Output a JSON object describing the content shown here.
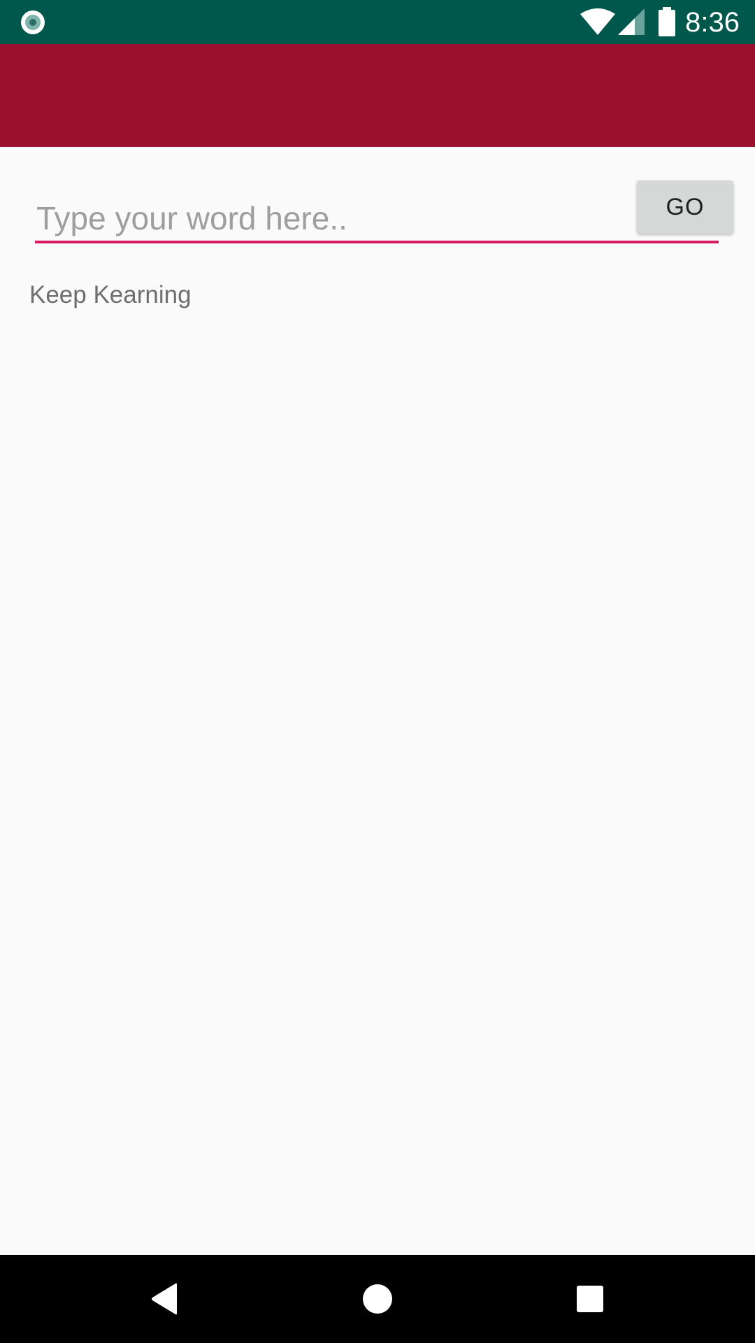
{
  "status_bar": {
    "time": "8:36",
    "background_color": "#00574b",
    "icons": [
      "notification-icon",
      "wifi-icon",
      "signal-icon",
      "battery-icon"
    ]
  },
  "toolbar": {
    "background_color": "#99112f"
  },
  "search": {
    "placeholder": "Type your word here..",
    "value": "",
    "underline_color": "#d81b60"
  },
  "go_button": {
    "label": "GO"
  },
  "result": {
    "text": "Keep Kearning"
  },
  "nav_bar": {
    "buttons": [
      "back-icon",
      "home-icon",
      "recents-icon"
    ]
  }
}
